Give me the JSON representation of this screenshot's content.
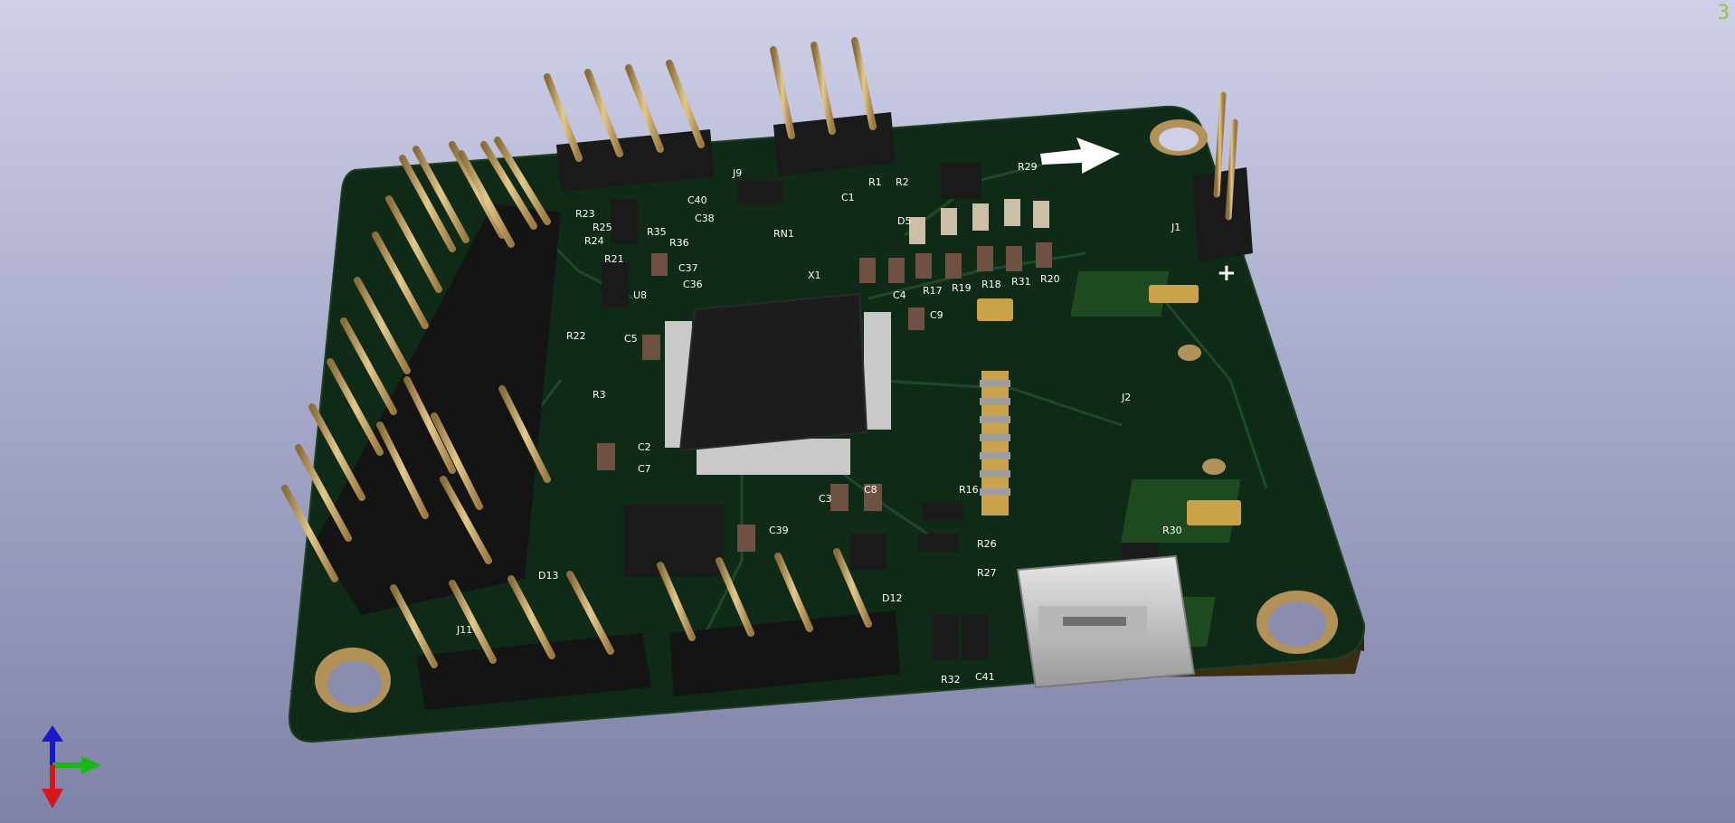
{
  "viewer": {
    "corner_glyph": "З",
    "axis_gizmo": {
      "icon": "xyz-axis-icon",
      "colors": {
        "x": "#18b818",
        "y": "#d41818",
        "z": "#1818c8"
      }
    }
  },
  "board": {
    "colors": {
      "soldermask": "#0f2a17",
      "edge": "#3a2e12",
      "copper": "#c9a24a",
      "header": "#1a1a1a",
      "pin": "#c9a86a",
      "usb": "#c8c8c8"
    },
    "silkscreen": {
      "refs": [
        "R23",
        "R22",
        "R21",
        "R3",
        "R25",
        "R24",
        "C5",
        "C2",
        "C7",
        "C37",
        "C36",
        "C40",
        "C38",
        "R35",
        "R36",
        "U8",
        "J9",
        "R1",
        "R2",
        "C1",
        "RN1",
        "X1",
        "C9",
        "C4",
        "R17",
        "R19",
        "R18",
        "R31",
        "R20",
        "D5",
        "R29",
        "R30",
        "R26",
        "R27",
        "R16",
        "C3",
        "C8",
        "C39",
        "D12",
        "D13",
        "J11",
        "R32",
        "C41",
        "J1",
        "J2"
      ],
      "plus_sign": "+",
      "arrow_icon": "right-arrow-icon"
    }
  }
}
